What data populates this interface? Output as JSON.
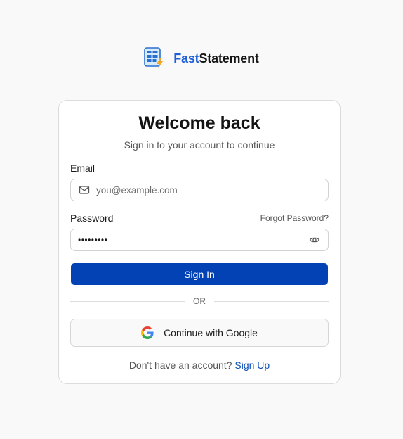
{
  "brand": {
    "name_part1": "Fast",
    "name_part2": "Statement",
    "color_primary": "#1f5fd6",
    "color_dark": "#161616"
  },
  "card": {
    "title": "Welcome back",
    "subtitle": "Sign in to your account to continue"
  },
  "email": {
    "label": "Email",
    "placeholder": "you@example.com",
    "value": "",
    "icon": "mail-icon"
  },
  "password": {
    "label": "Password",
    "forgot_label": "Forgot Password?",
    "value": "*********",
    "icon": "eye-icon"
  },
  "signin_button": {
    "label": "Sign In",
    "color": "#0342b4"
  },
  "divider_text": "OR",
  "google_button": {
    "label": "Continue with Google",
    "icon": "google-icon"
  },
  "signup": {
    "prompt": "Don't have an account?",
    "link_label": "Sign Up"
  }
}
